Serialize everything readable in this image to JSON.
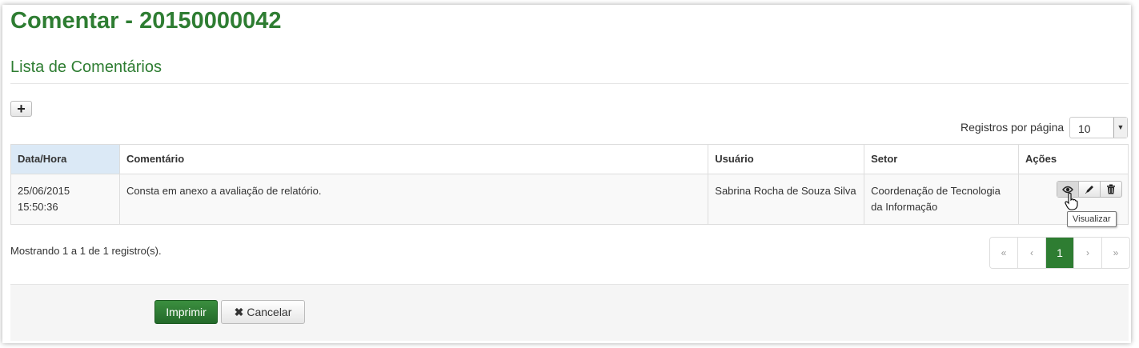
{
  "page": {
    "title": "Comentar - 20150000042"
  },
  "section": {
    "title": "Lista de Comentários"
  },
  "toolbar": {
    "add_icon": "plus-icon"
  },
  "per_page": {
    "label": "Registros por página",
    "value": "10"
  },
  "table": {
    "headers": [
      "Data/Hora",
      "Comentário",
      "Usuário",
      "Setor",
      "Ações"
    ],
    "rows": [
      {
        "datetime": "25/06/2015 15:50:36",
        "comment": "Consta em anexo a avaliação de relatório.",
        "user": "Sabrina Rocha de Souza Silva",
        "sector": "Coordenação de Tecnologia da Informação"
      }
    ]
  },
  "row_actions": {
    "icons": [
      "eye-icon",
      "pencil-icon",
      "trash-icon"
    ],
    "tooltip": "Visualizar"
  },
  "summary": {
    "text": "Mostrando 1 a 1 de 1 registro(s)."
  },
  "pagination": {
    "first": "«",
    "prev": "‹",
    "current": "1",
    "next": "›",
    "last": "»"
  },
  "footer": {
    "print_label": "Imprimir",
    "cancel_label": "Cancelar"
  },
  "colors": {
    "accent": "#2e7d32",
    "sorted_header": "#dbe9f6"
  }
}
